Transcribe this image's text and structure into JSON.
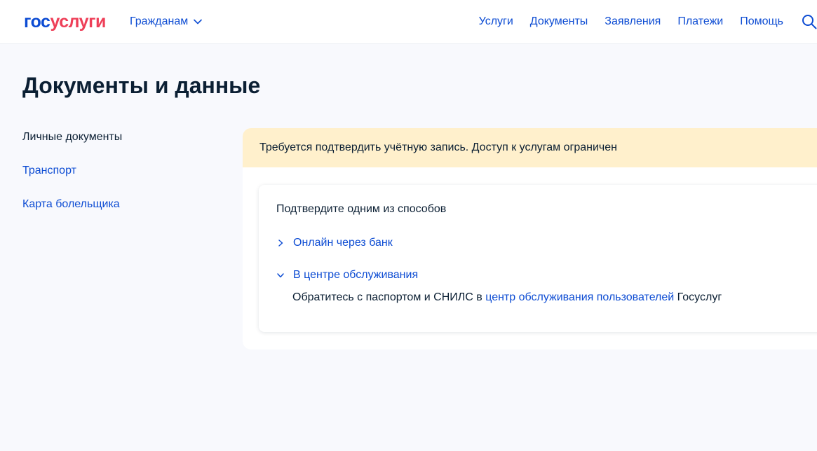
{
  "header": {
    "logo": {
      "part1": "гос",
      "part2": "услуги"
    },
    "role_select": {
      "label": "Гражданам",
      "icon": "chevron-down-icon"
    },
    "nav": [
      {
        "label": "Услуги"
      },
      {
        "label": "Документы"
      },
      {
        "label": "Заявления"
      },
      {
        "label": "Платежи"
      },
      {
        "label": "Помощь"
      }
    ],
    "search_icon": "search-icon"
  },
  "page": {
    "title": "Документы и данные"
  },
  "sidebar": {
    "items": [
      {
        "label": "Личные документы",
        "active": true
      },
      {
        "label": "Транспорт",
        "active": false
      },
      {
        "label": "Карта болельщика",
        "active": false
      }
    ]
  },
  "main": {
    "alert": "Требуется подтвердить учётную запись. Доступ к услугам ограничен",
    "confirm": {
      "title": "Подтвердите одним из способов",
      "methods": [
        {
          "label": "Онлайн через банк",
          "expanded": false,
          "icon": "chevron-right-icon"
        },
        {
          "label": "В центре обслуживания",
          "expanded": true,
          "icon": "chevron-down-icon"
        }
      ],
      "description": {
        "before": "Обратитесь с паспортом и СНИЛС в ",
        "link": "центр обслуживания пользователей",
        "after": " Госуслуг"
      }
    }
  },
  "colors": {
    "link": "#0d4cd3",
    "logo_red": "#ee3f58",
    "alert_bg": "#fff0cc",
    "text": "#0b1f33",
    "page_bg": "#f8f9fd"
  }
}
